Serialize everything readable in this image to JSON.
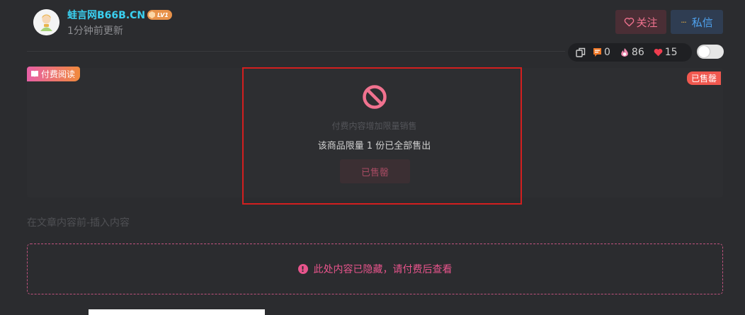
{
  "author": {
    "name": "蛙言网B66B.CN",
    "level": "LV1",
    "update_time": "1分钟前更新"
  },
  "actions": {
    "follow_label": "关注",
    "message_label": "私信"
  },
  "stats": {
    "comments": "0",
    "views": "86",
    "likes": "15"
  },
  "paid_section": {
    "tag_label": "付费阅读",
    "status_badge": "已售罄",
    "limit_title": "付费内容增加限量销售",
    "limit_desc": "该商品限量 1 份已全部售出",
    "soldout_button": "已售罄"
  },
  "insert_note": "在文章内容前-插入内容",
  "hidden_notice": "此处内容已隐藏，请付费后查看",
  "icons": {
    "copy": "copy-icon",
    "comment": "comment-icon",
    "view": "fire-icon",
    "like": "heart-icon",
    "ban": "ban-icon",
    "warning": "warning-icon"
  },
  "colors": {
    "author_name": "#3ad0f0",
    "follow": "#f0728f",
    "message": "#4fa3f0",
    "sold_badge": "#f0584f",
    "ban_icon": "#f0728f",
    "hidden_notice": "#e8548c",
    "highlight_border": "#d31f1f"
  }
}
